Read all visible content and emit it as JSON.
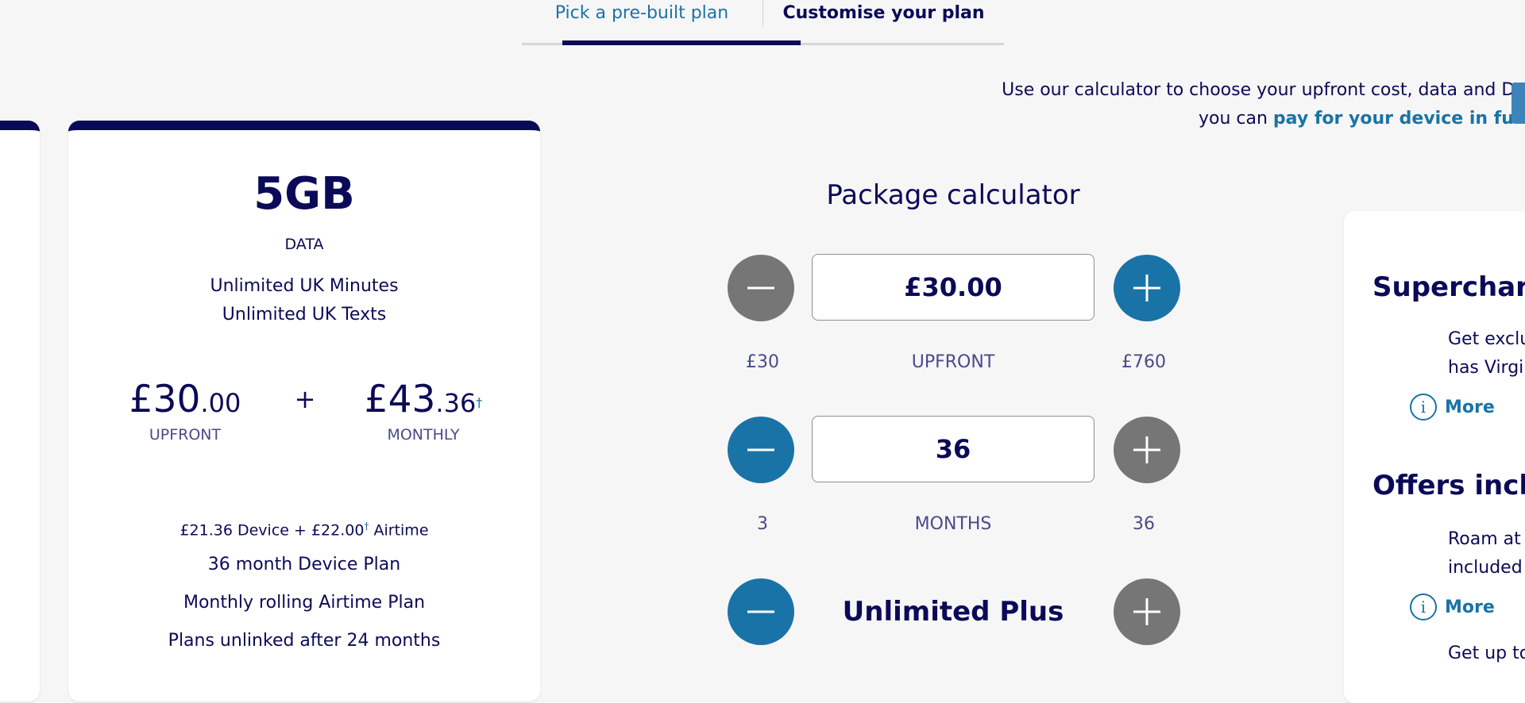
{
  "tabs": {
    "prebuilt_label": "Pick a pre-built plan",
    "customise_label": "Customise your plan"
  },
  "intro": {
    "line1": "Use our calculator to choose your upfront cost, data and Devi",
    "line2_prefix": "you can ",
    "line2_link": "pay for your device in full",
    "line2_suffix": "."
  },
  "plan_card": {
    "data_amount": "5GB",
    "data_label": "DATA",
    "minutes": "Unlimited UK Minutes",
    "texts": "Unlimited UK Texts",
    "upfront_main": "£30",
    "upfront_dec": ".00",
    "upfront_label": "UPFRONT",
    "plus": "+",
    "monthly_main": "£43",
    "monthly_dec": ".36",
    "monthly_mark": "†",
    "monthly_label": "MONTHLY",
    "breakdown_a": "£21.36 Device + £22.00",
    "breakdown_mark": "†",
    "breakdown_b": " Airtime",
    "device_plan": "36 month Device Plan",
    "airtime_plan": "Monthly rolling Airtime Plan",
    "unlinked": "Plans unlinked after 24 months"
  },
  "calculator": {
    "title": "Package calculator",
    "upfront": {
      "value": "£30.00",
      "min": "£30",
      "label": "UPFRONT",
      "max": "£760"
    },
    "months": {
      "value": "36",
      "min": "3",
      "label": "MONTHS",
      "max": "36"
    },
    "data": {
      "value": "Unlimited Plus"
    },
    "colors": {
      "active": "#1a73a6",
      "disabled": "#767676"
    }
  },
  "right_panel": {
    "heading1": "Supercharg",
    "text1_line1": "Get exclu",
    "text1_line2": "has Virgi",
    "more1": "More",
    "heading2": "Offers inclu",
    "text2_line1": "Roam at",
    "text2_line2": "included",
    "more2": "More",
    "text3": "Get up to"
  }
}
